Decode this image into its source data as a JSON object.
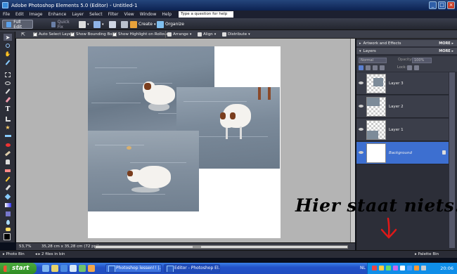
{
  "window": {
    "title": "Adobe Photoshop Elements 5.0 (Editor) - Untitled-1",
    "buttons": [
      "_",
      "□",
      "×"
    ]
  },
  "menu": {
    "items": [
      "File",
      "Edit",
      "Image",
      "Enhance",
      "Layer",
      "Select",
      "Filter",
      "View",
      "Window",
      "Help"
    ],
    "help_placeholder": "Type a question for help"
  },
  "shortcuts": {
    "full_edit": "Full Edit",
    "quick_fix": "Quick Fix",
    "create": "Create",
    "organize": "Organize"
  },
  "options": {
    "auto_select": "Auto Select Layer",
    "bounding_box": "Show Bounding Box",
    "highlight": "Show Highlight on Rollover",
    "arrange": "Arrange",
    "align": "Align",
    "distribute": "Distribute"
  },
  "status": {
    "zoom": "53,7%",
    "doc_size": "35,28 cm x 35,28 cm (72 ppi)"
  },
  "photo_bin": {
    "label": "Photo Bin",
    "files": "2 files in bin",
    "palette_bin": "Palette Bin"
  },
  "panel": {
    "artwork_title": "Artwork and Effects",
    "layers_title": "Layers",
    "more": "MORE",
    "blend_mode": "Normal",
    "opacity_label": "Opacity:",
    "opacity_value": "100%",
    "lock_label": "Lock:",
    "layers": [
      {
        "name": "Layer 3",
        "selected": false
      },
      {
        "name": "Layer 2",
        "selected": false
      },
      {
        "name": "Layer 1",
        "selected": false
      },
      {
        "name": "Background",
        "selected": true
      }
    ]
  },
  "annotation": {
    "text": "Hier staat niets...",
    "arrow_color": "#e01818"
  },
  "taskbar": {
    "start": "start",
    "tasks": [
      "Photoshop lessen!! |...",
      "Editor - Photoshop El..."
    ],
    "lang": "NL",
    "clock": "20:06"
  },
  "colors": {
    "selected_layer": "#3d6fd0",
    "canvas_bg": "#b4b4b4",
    "taskbar": "#2352c8"
  }
}
